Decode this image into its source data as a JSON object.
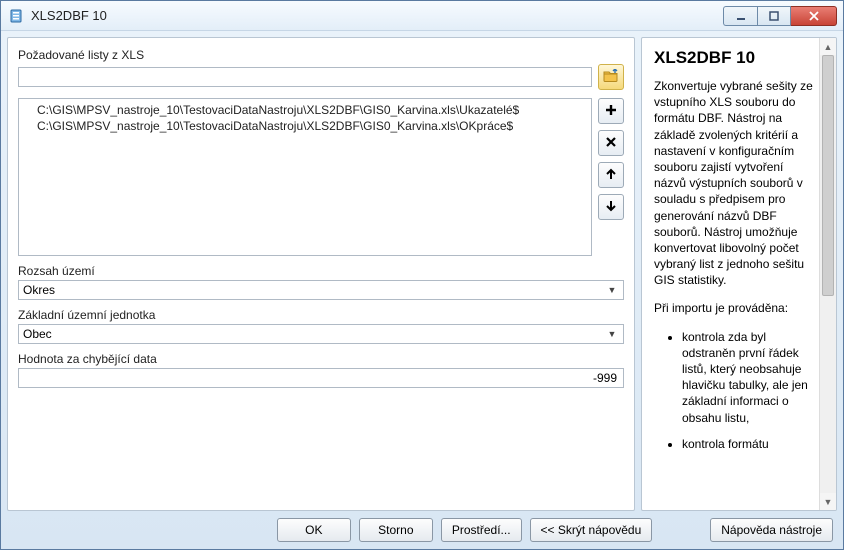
{
  "window": {
    "title": "XLS2DBF 10"
  },
  "left": {
    "sheets_label": "Požadované listy z XLS",
    "path_value": "",
    "items": [
      "C:\\GIS\\MPSV_nastroje_10\\TestovaciDataNastroju\\XLS2DBF\\GIS0_Karvina.xls\\Ukazatelé$",
      "C:\\GIS\\MPSV_nastroje_10\\TestovaciDataNastroju\\XLS2DBF\\GIS0_Karvina.xls\\OKpráce$"
    ],
    "extent_label": "Rozsah území",
    "extent_value": "Okres",
    "unit_label": "Základní územní jednotka",
    "unit_value": "Obec",
    "missing_label": "Hodnota za chybějící data",
    "missing_value": "-999"
  },
  "buttons": {
    "ok": "OK",
    "cancel": "Storno",
    "env": "Prostředí...",
    "hide_help": "<< Skrýt nápovědu",
    "tool_help": "Nápověda nástroje"
  },
  "help": {
    "title": "XLS2DBF 10",
    "p1": "Zkonvertuje vybrané sešity ze vstupního XLS souboru do formátu DBF. Nástroj na základě zvolených kritérií a nastavení v konfiguračním souboru zajistí vytvoření názvů výstupních souborů v souladu s předpisem pro generování názvů DBF souborů. Nástroj umožňuje konvertovat libovolný počet vybraný list z jednoho sešitu GIS statistiky.",
    "p2": "Při importu je prováděna:",
    "li1": "kontrola zda byl odstraněn první řádek listů, který neobsahuje hlavičku tabulky, ale jen základní informaci o obsahu listu,",
    "li2": "kontrola formátu"
  }
}
